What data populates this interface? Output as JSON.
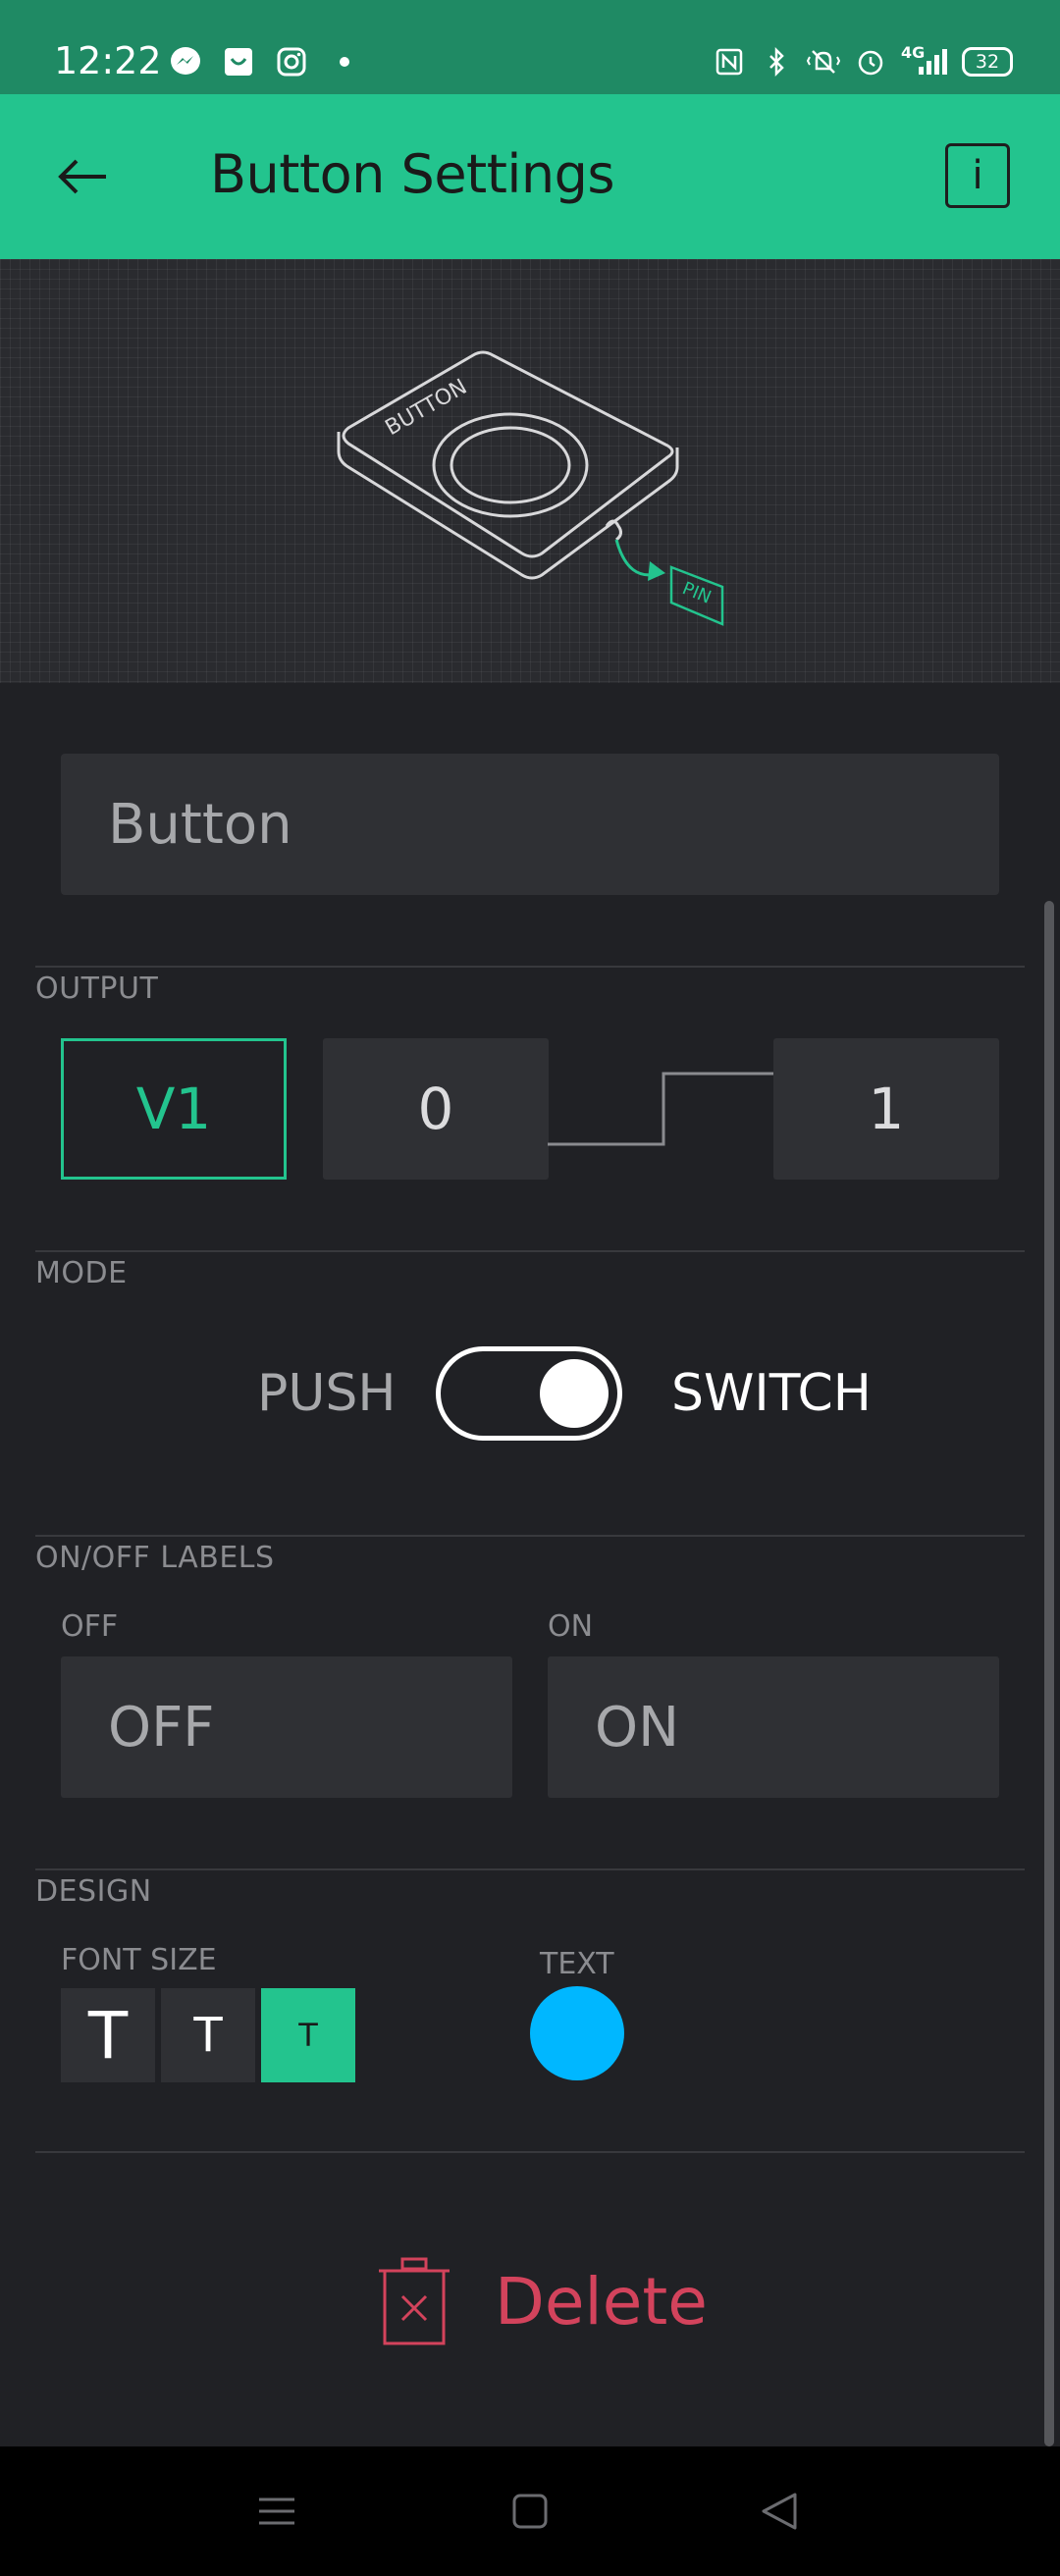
{
  "status_bar": {
    "time": "12:22",
    "left_icons": [
      "messenger-icon",
      "shopping-bag-icon",
      "instagram-icon",
      "dot-icon"
    ],
    "right_icons": [
      "nfc-icon",
      "bluetooth-icon",
      "silent-icon",
      "alarm-icon",
      "signal-icon"
    ],
    "network": "4G",
    "battery": "32"
  },
  "app_bar": {
    "title": "Button Settings",
    "info_label": "i"
  },
  "illustration": {
    "device_label": "BUTTON",
    "pin_label": "PIN"
  },
  "name_field": {
    "value": "Button"
  },
  "output": {
    "section_label": "OUTPUT",
    "pin": "V1",
    "low": "0",
    "high": "1"
  },
  "mode": {
    "section_label": "MODE",
    "push_label": "PUSH",
    "switch_label": "SWITCH",
    "selected": "SWITCH"
  },
  "onoff": {
    "section_label": "ON/OFF LABELS",
    "off_caption": "OFF",
    "on_caption": "ON",
    "off_value": "OFF",
    "on_value": "ON"
  },
  "design": {
    "section_label": "DESIGN",
    "font_size_label": "FONT SIZE",
    "text_label": "TEXT",
    "font_sizes": [
      "T",
      "T",
      "T"
    ],
    "selected_font_size": 2,
    "text_color": "#00b7ff"
  },
  "delete": {
    "label": "Delete"
  },
  "colors": {
    "accent": "#23c48e",
    "status_bar": "#1f8a64",
    "background": "#202125",
    "delete": "#d3435c"
  }
}
